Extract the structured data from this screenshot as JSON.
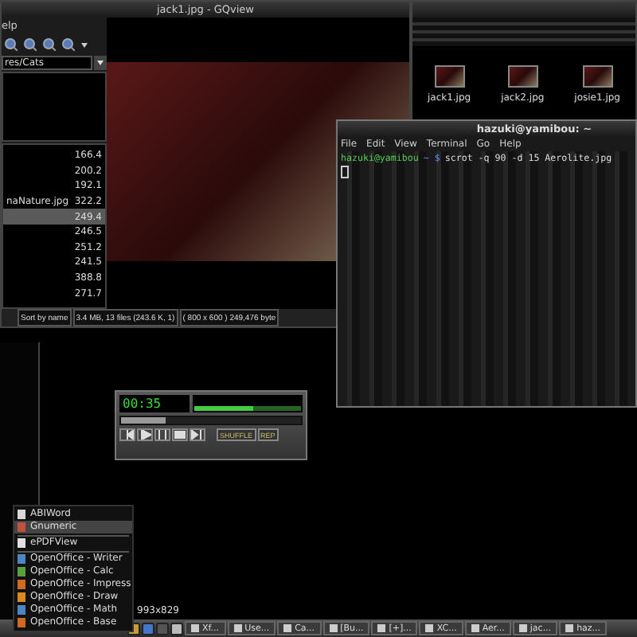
{
  "gqview": {
    "title": "jack1.jpg - GQview",
    "menu": [
      "elp"
    ],
    "path": "res/Cats",
    "files": [
      {
        "size": "166.4",
        "selected": false
      },
      {
        "size": "200.2",
        "selected": false
      },
      {
        "size": "192.1",
        "selected": false
      },
      {
        "name": "naNature.jpg",
        "size": "322.2",
        "selected": false
      },
      {
        "size": "249.4",
        "selected": true
      },
      {
        "size": "246.5",
        "selected": false
      },
      {
        "size": "251.2",
        "selected": false
      },
      {
        "size": "241.5",
        "selected": false
      },
      {
        "size": "388.8",
        "selected": false
      },
      {
        "size": "271.7",
        "selected": false
      }
    ],
    "status": [
      "Sort by name",
      "3.4 MB, 13 files (243.6 K, 1)",
      "( 800 x 600 ) 249,476 byte"
    ]
  },
  "file_manager": {
    "thumbnails": [
      {
        "label": "jack1.jpg"
      },
      {
        "label": "jack2.jpg"
      },
      {
        "label": "josie1.jpg"
      }
    ]
  },
  "terminal": {
    "title": "hazuki@yamibou: ~",
    "menu": [
      "File",
      "Edit",
      "View",
      "Terminal",
      "Go",
      "Help"
    ],
    "prompt_user": "hazuki@yamibou",
    "prompt_path": "~ $",
    "command": "scrot -q 90 -d 15 Aerolite.jpg"
  },
  "player": {
    "time": "00:35",
    "shuffle": "SHUFFLE",
    "repeat": "REP",
    "seek": {
      "level": 0.25
    },
    "volume": {
      "level": 0.55
    }
  },
  "app_menu": {
    "items": [
      {
        "label": "ABIWord",
        "selected": false,
        "separator_after": false,
        "color": "#d8d8d8"
      },
      {
        "label": "Gnumeric",
        "selected": true,
        "separator_after": true,
        "color": "#c05040"
      },
      {
        "label": "ePDFView",
        "selected": false,
        "separator_after": true,
        "color": "#e0e0e0"
      },
      {
        "label": "OpenOffice - Writer",
        "selected": false,
        "separator_after": false,
        "color": "#4a86c0"
      },
      {
        "label": "OpenOffice - Calc",
        "selected": false,
        "separator_after": false,
        "color": "#5aa040"
      },
      {
        "label": "OpenOffice - Impress",
        "selected": false,
        "separator_after": false,
        "color": "#d06a20"
      },
      {
        "label": "OpenOffice - Draw",
        "selected": false,
        "separator_after": false,
        "color": "#d88a20"
      },
      {
        "label": "OpenOffice - Math",
        "selected": false,
        "separator_after": false,
        "color": "#4a86c0"
      },
      {
        "label": "OpenOffice - Base",
        "selected": false,
        "separator_after": false,
        "color": "#d06a20"
      }
    ]
  },
  "desktop_text": "993x829",
  "taskbar": {
    "items": [
      "Xf...",
      "Use...",
      "Ca...",
      "[Bu...",
      "[+]...",
      "XC...",
      "Aer...",
      "jac...",
      "haz..."
    ]
  }
}
